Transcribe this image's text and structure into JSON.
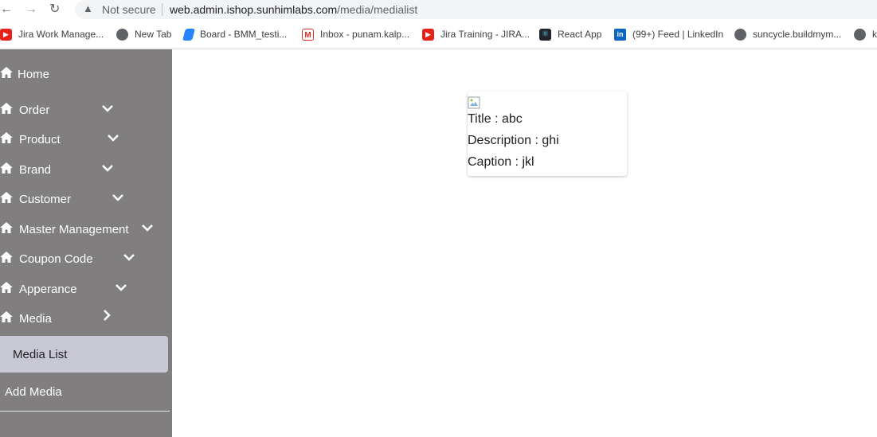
{
  "browser": {
    "security_label": "Not secure",
    "url_host": "web.admin.ishop.sunhimlabs.com",
    "url_path": "/media/medialist",
    "bookmarks": [
      {
        "label": "Jira Work Manage...",
        "icon": "youtube-icon"
      },
      {
        "label": "New Tab",
        "icon": "globe-icon"
      },
      {
        "label": "Board - BMM_testi...",
        "icon": "jira-icon"
      },
      {
        "label": "Inbox - punam.kalp...",
        "icon": "gmail-icon"
      },
      {
        "label": "Jira Training - JIRA...",
        "icon": "youtube-icon"
      },
      {
        "label": "React App",
        "icon": "react-icon"
      },
      {
        "label": "(99+) Feed | LinkedIn",
        "icon": "linkedin-icon"
      },
      {
        "label": "suncycle.buildmym...",
        "icon": "globe-icon"
      },
      {
        "label": "k",
        "icon": "globe-icon"
      }
    ]
  },
  "sidebar": {
    "items": [
      {
        "label": "Home"
      },
      {
        "label": "Order"
      },
      {
        "label": "Product"
      },
      {
        "label": "Brand"
      },
      {
        "label": "Customer"
      },
      {
        "label": "Master Management"
      },
      {
        "label": "Coupon Code"
      },
      {
        "label": "Apperance"
      },
      {
        "label": "Media"
      }
    ],
    "sub_items": [
      {
        "label": "Media List"
      },
      {
        "label": "Add Media"
      }
    ]
  },
  "media_card": {
    "title": "Title : abc",
    "description": "Description : ghi",
    "caption": "Caption : jkl"
  },
  "colors": {
    "sidebar_bg": "#807e7e",
    "active_sub_bg": "#c8c7d4"
  }
}
